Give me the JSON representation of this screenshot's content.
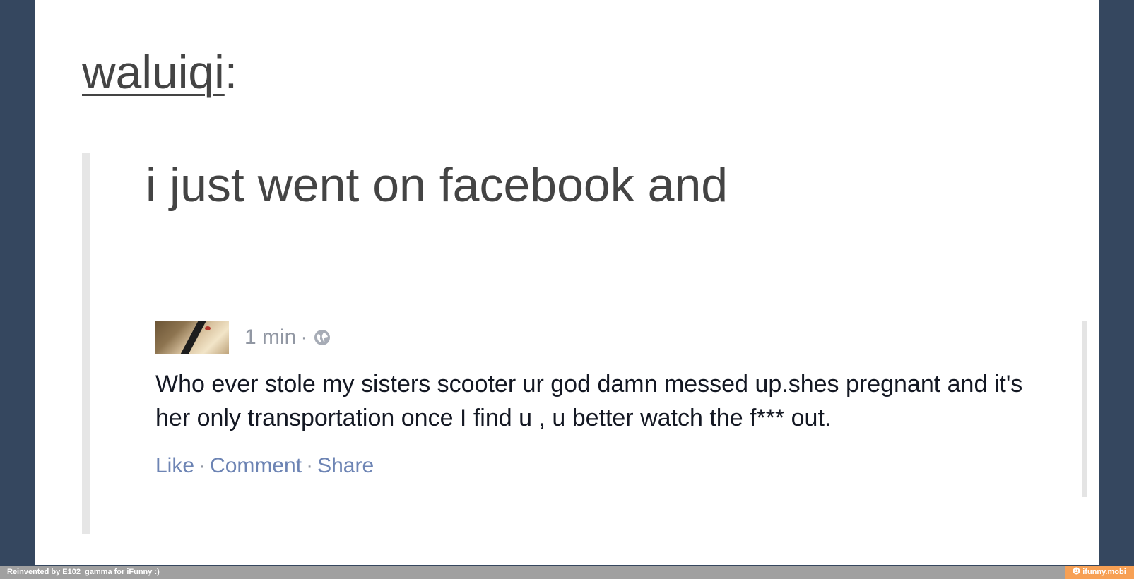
{
  "post": {
    "username": "waluiqi",
    "colon": ":",
    "quote": "i just went on facebook and"
  },
  "fb_post": {
    "time": "1 min",
    "dot": "·",
    "privacy_icon": "globe-icon",
    "body": "Who ever stole my sisters scooter ur god damn messed up.shes pregnant and it's her only transportation once I find u , u better watch the f*** out.",
    "actions": {
      "like": "Like",
      "comment": "Comment",
      "share": "Share",
      "separator": "·"
    }
  },
  "footer": {
    "credit": "Reinvented by E102_gamma for iFunny :)",
    "brand": "ifunny.mobi",
    "brand_icon": "smile-icon"
  },
  "colors": {
    "background": "#35475f",
    "card": "#ffffff",
    "text": "#444444",
    "fb_link": "#6d84b4",
    "fb_meta": "#9197a3",
    "footer_bar": "#a0a0a0",
    "footer_brand": "#f7a054"
  }
}
